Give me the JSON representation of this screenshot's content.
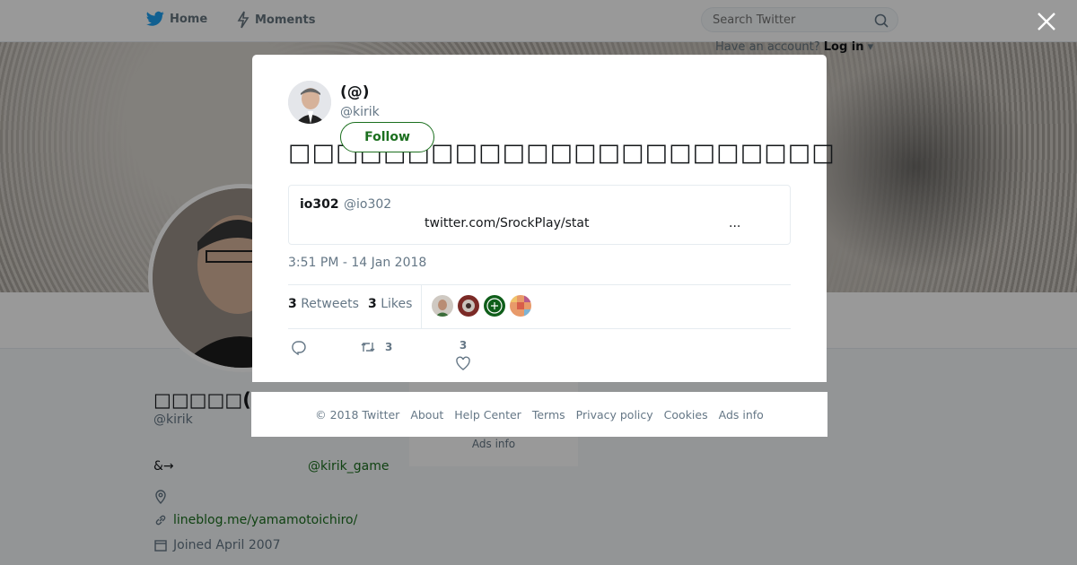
{
  "topbar": {
    "home_label": "Home",
    "moments_label": "Moments",
    "search_placeholder": "Search Twitter",
    "login_prompt": "Have an account?",
    "login_label": "Log in"
  },
  "profile": {
    "name": "□□□□□(□□□□",
    "handle": "@kirik",
    "bio": "&→",
    "bio_link": "@kirik_game",
    "website": "lineblog.me/yamamotoichiro/",
    "joined": "Joined April 2007",
    "side_ads": "Ads info"
  },
  "tweet": {
    "name": "(@)",
    "handle": "@kirik",
    "follow_label": "Follow",
    "text": "□□□□□□□□□□□□□□□□□□□□□□□",
    "quote": {
      "name": "io302",
      "handle": "@io302",
      "link": "twitter.com/SrockPlay/stat",
      "ellipsis": "..."
    },
    "timestamp": "3:51 PM - 14 Jan 2018",
    "retweets_count": "3",
    "retweets_label": "Retweets",
    "likes_count": "3",
    "likes_label": "Likes",
    "action_retweet_count": "3",
    "action_like_count": "3"
  },
  "footer": {
    "copyright": "© 2018 Twitter",
    "about": "About",
    "help": "Help Center",
    "terms": "Terms",
    "privacy": "Privacy policy",
    "cookies": "Cookies",
    "ads": "Ads info"
  },
  "colors": {
    "accent": "#1b6f1e",
    "twitter_blue": "#1da1f2",
    "overlay": "rgba(0,0,0,0.40)"
  },
  "icons": [
    "twitter-bird-icon",
    "lightning-icon",
    "search-icon",
    "close-icon",
    "location-icon",
    "link-icon",
    "calendar-icon",
    "reply-icon",
    "retweet-icon",
    "heart-icon"
  ]
}
